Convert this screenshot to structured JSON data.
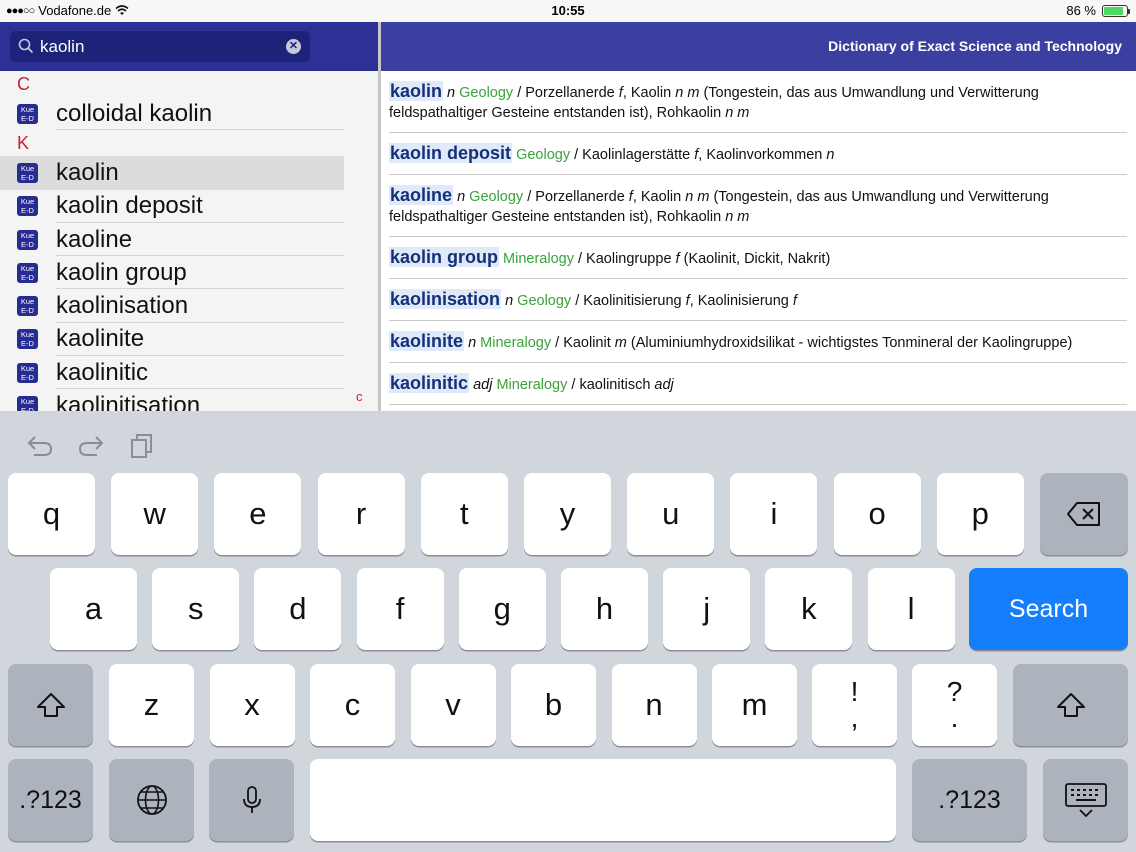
{
  "status": {
    "carrier": "Vodafone.de",
    "time": "10:55",
    "battery_text": "86 %",
    "battery_level": 0.86
  },
  "search": {
    "value": "kaolin",
    "placeholder": ""
  },
  "list": {
    "sections": [
      {
        "letter": "C",
        "items": [
          "colloidal kaolin"
        ]
      },
      {
        "letter": "K",
        "items": [
          "kaolin",
          "kaolin deposit",
          "kaoline",
          "kaolin group",
          "kaolinisation",
          "kaolinite",
          "kaolinitic",
          "kaolinitisation"
        ]
      }
    ],
    "icon_text_top": "Kue",
    "icon_text_bottom": "E-D",
    "selected_item": "kaolin",
    "index_letter": "c"
  },
  "detail": {
    "title": "Dictionary of Exact Science and Technology",
    "entries": [
      {
        "hw": "kaolin",
        "pos": "n",
        "domain": "Geology",
        "text": "/ Porzellanerde f, Kaolin n m (Tongestein, das aus Umwandlung und Verwitterung feldspathaltiger Gesteine entstanden ist), Rohkaolin n m"
      },
      {
        "hw": "kaolin deposit",
        "pos": "",
        "domain": "Geology",
        "text": "/ Kaolinlagerstätte f, Kaolinvorkommen n"
      },
      {
        "hw": "kaoline",
        "pos": "n",
        "domain": "Geology",
        "text": "/ Porzellanerde f, Kaolin n m (Tongestein, das aus Umwandlung und Verwitterung feldspathaltiger Gesteine entstanden ist), Rohkaolin n m"
      },
      {
        "hw": "kaolin group",
        "pos": "",
        "domain": "Mineralogy",
        "text": "/ Kaolingruppe f (Kaolinit, Dickit, Nakrit)"
      },
      {
        "hw": "kaolinisation",
        "pos": "n",
        "domain": "Geology",
        "text": "/ Kaolinitisierung f, Kaolinisierung f"
      },
      {
        "hw": "kaolinite",
        "pos": "n",
        "domain": "Mineralogy",
        "text": "/ Kaolinit m (Aluminiumhydroxidsilikat - wichtigstes Tonmineral der Kaolingruppe)"
      },
      {
        "hw": "kaolinitic",
        "pos": "adj",
        "domain": "Mineralogy",
        "text": "/ kaolinitisch adj"
      }
    ]
  },
  "keyboard": {
    "row1": [
      "q",
      "w",
      "e",
      "r",
      "t",
      "y",
      "u",
      "i",
      "o",
      "p"
    ],
    "row2": [
      "a",
      "s",
      "d",
      "f",
      "g",
      "h",
      "j",
      "k",
      "l"
    ],
    "row3": [
      "z",
      "x",
      "c",
      "v",
      "b",
      "n",
      "m"
    ],
    "punct1": [
      "!",
      ","
    ],
    "punct2": [
      "?",
      "."
    ],
    "search_label": "Search",
    "numbers_label": ".?123"
  },
  "colors": {
    "search_bar": "#2d3196",
    "header": "#3b3f9f",
    "domain_green": "#3aa33a",
    "section_red": "#c0272d",
    "search_key": "#157efb"
  }
}
